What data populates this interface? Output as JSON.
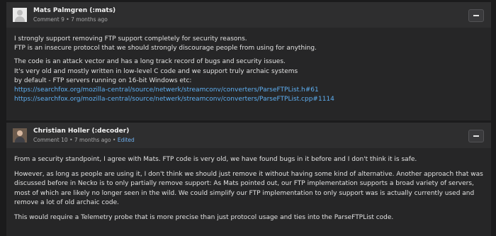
{
  "comments": [
    {
      "author": "Mats Palmgren (:mats)",
      "number": "Comment 9",
      "time": "7 months ago",
      "body": {
        "p1": [
          "I strongly support removing FTP support completely for security reasons.",
          "FTP is an insecure protocol that we should strongly discourage people from using for anything."
        ],
        "p2": [
          "The code is an attack vector and has a long track record of bugs and security issues.",
          "It's very old and mostly written in low-level C code and we support truly archaic systems",
          "by default - FTP servers running on 16-bit Windows etc:"
        ],
        "links": [
          "https://searchfox.org/mozilla-central/source/netwerk/streamconv/converters/ParseFTPList.h#61",
          "https://searchfox.org/mozilla-central/source/netwerk/streamconv/converters/ParseFTPList.cpp#1114"
        ]
      }
    },
    {
      "author": "Christian Holler (:decoder)",
      "number": "Comment 10",
      "time": "7 months ago",
      "edited": "Edited",
      "body": {
        "p1": "From a security standpoint, I agree with Mats. FTP code is very old, we have found bugs in it before and I don't think it is safe.",
        "p2": [
          "However, as long as people are using it, I don't think we should just remove it without having some kind of alternative. Another approach that was",
          "discussed before in Necko is to only partially remove support: As Mats pointed out, our FTP implementation supports a broad variety of servers,",
          "most of which are likely no longer seen in the wild. We could simplify our FTP implementation to only support was is actually currently used and",
          "remove a lot of old archaic code."
        ],
        "p3": "This would require a Telemetry probe that is more precise than just protocol usage and ties into the ParseFTPList code."
      }
    }
  ],
  "separator": "•"
}
